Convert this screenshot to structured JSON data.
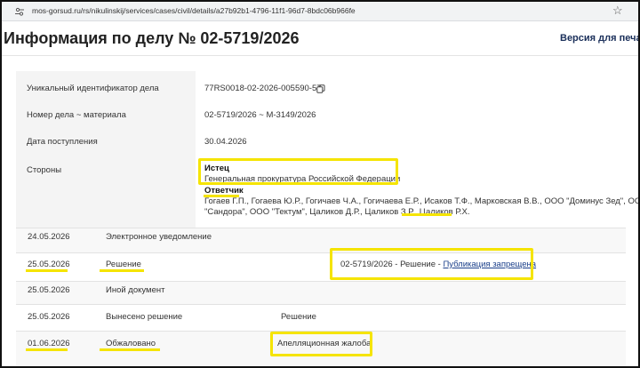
{
  "browser": {
    "url": "mos-gorsud.ru/rs/nikulinskij/services/cases/civil/details/a27b92b1-4796-11f1-96d7-8bdc06b966fe",
    "site_icon": "site-settings-icon",
    "bookmark_icon": "star-icon"
  },
  "header": {
    "title": "Информация по делу № 02-5719/2026",
    "print_link": "Версия для печати"
  },
  "case": {
    "uid_label": "Уникальный идентификатор дела",
    "uid_value": "77RS0018-02-2026-005590-57",
    "number_label": "Номер дела ~ материала",
    "number_value": "02-5719/2026 ~ М-3149/2026",
    "date_label": "Дата поступления",
    "date_value": "30.04.2026",
    "parties_label": "Стороны",
    "plaintiff_heading": "Истец",
    "plaintiff": "Генеральная прокуратура Российской Федерации",
    "defendant_heading": "Ответчик",
    "defendants_line1": "Гогаев Г.П., Гогаева Ю.Р., Гогичаев Ч.А., Гогичаева Е.Р., Исаков Т.Ф., Марковская В.В., ООО \"Доминус Зед\", ООО",
    "defendants_line2": "\"Сандора\", ООО \"Тектум\", Цаликов Д.Р., Цаликов З.Р., Цаликов Р.Х."
  },
  "events": [
    {
      "date": "24.05.2026",
      "type": "Электронное уведомление",
      "detail": ""
    },
    {
      "date": "25.05.2026",
      "type": "Решение",
      "detail_text": "02-5719/2026 - Решение - ",
      "detail_link": "Публикация запрещена"
    },
    {
      "date": "25.05.2026",
      "type": "Иной документ",
      "detail": ""
    },
    {
      "date": "25.05.2026",
      "type": "Вынесено решение",
      "detail": "Решение"
    },
    {
      "date": "01.06.2026",
      "type": "Обжаловано",
      "detail": "Апелляционная жалоба"
    }
  ],
  "colors": {
    "highlight": "#f5e400",
    "link": "#1a3f8a",
    "panel_bg": "#f4f4f4"
  }
}
